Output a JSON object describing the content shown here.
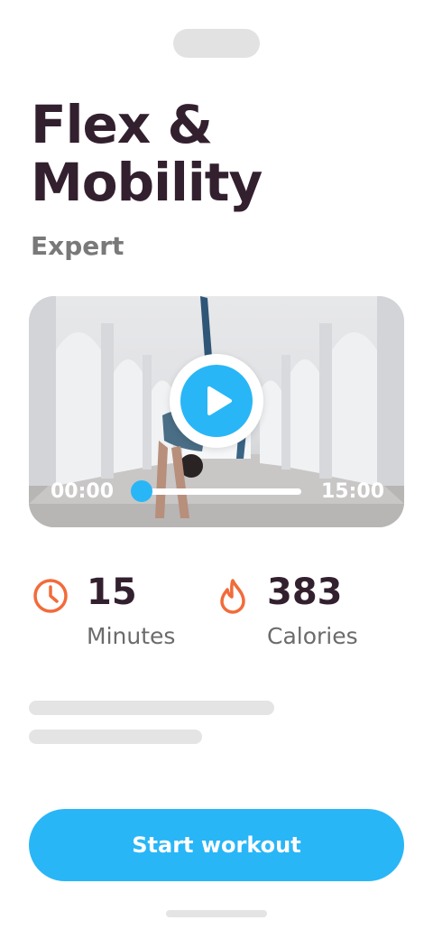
{
  "workout": {
    "title": "Flex & Mobility",
    "level": "Expert"
  },
  "video": {
    "current_time": "00:00",
    "duration": "15:00",
    "progress": 0,
    "play_icon": "play-icon"
  },
  "stats": {
    "duration": {
      "value": "15",
      "label": "Minutes",
      "icon": "clock-icon"
    },
    "calories": {
      "value": "383",
      "label": "Calories",
      "icon": "flame-icon"
    }
  },
  "cta": {
    "label": "Start workout"
  },
  "colors": {
    "accent": "#29b6f6",
    "icon_orange": "#f26b3a",
    "title": "#33202f",
    "muted": "#797979"
  }
}
